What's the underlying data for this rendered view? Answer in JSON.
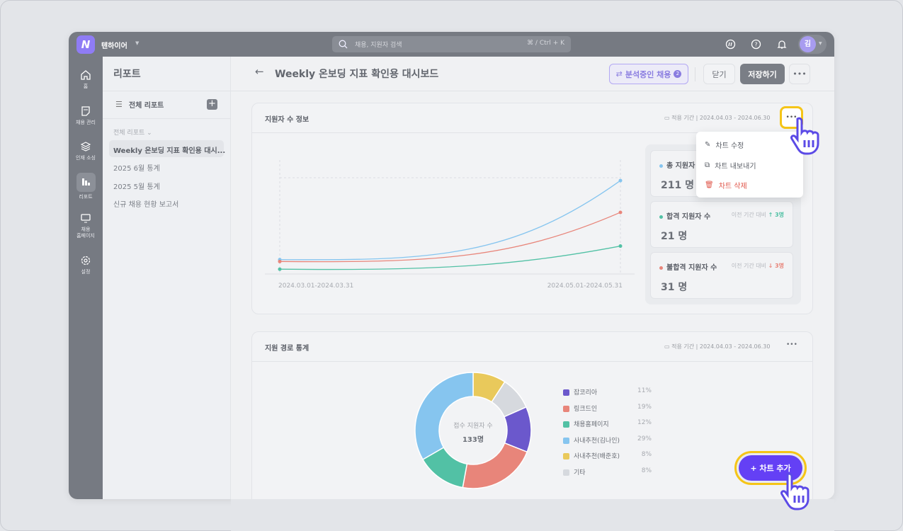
{
  "topbar": {
    "workspace": "텐하이어",
    "search_placeholder": "채용, 지원자 검색",
    "search_shortcut": "⌘ / Ctrl + K",
    "avatar": "김",
    "icons": [
      "chat-icon",
      "help-icon",
      "bell-icon"
    ]
  },
  "rail": [
    {
      "label": "홈",
      "icon": "home-icon"
    },
    {
      "label": "채용 관리",
      "icon": "note-icon"
    },
    {
      "label": "인재 소싱",
      "icon": "layers-icon"
    },
    {
      "label": "리포트",
      "icon": "bar-chart-icon",
      "active": true
    },
    {
      "label": "채용\n홈페이지",
      "icon": "monitor-icon"
    },
    {
      "label": "설정",
      "icon": "gear-icon"
    }
  ],
  "sidebar": {
    "title": "리포트",
    "all_reports": "전체 리포트",
    "section": "전체 리포트",
    "items": [
      "Weekly 온보딩 지표 확인용 대시...",
      "2025 6월 통계",
      "2025 5월 통계",
      "신규 채용 현황 보고서"
    ]
  },
  "header": {
    "title": "Weekly 온보딩 지표 확인용 대시보드",
    "analyzing": "분석중인 채용",
    "analyzing_count": "2",
    "close": "닫기",
    "save": "저장하기"
  },
  "card1": {
    "title": "지원자 수 정보",
    "period_label": "적용 기간",
    "period": "2024.04.03 - 2024.06.30",
    "stats": [
      {
        "label": "총 지원자 수",
        "value": "211 명",
        "color": "#86c5ef"
      },
      {
        "label": "합격 지원자 수",
        "value": "21 명",
        "compare": "이전 기간 대비",
        "delta": "↑ 3명",
        "color": "#52c1a5"
      },
      {
        "label": "불합격 지원자 수",
        "value": "31 명",
        "compare": "이전 기간 대비",
        "delta": "↓ 3명",
        "color": "#e8857a"
      }
    ]
  },
  "menu": {
    "items": [
      {
        "label": "차트 수정",
        "icon": "pencil-icon"
      },
      {
        "label": "차트 내보내기",
        "icon": "copy-icon"
      },
      {
        "label": "차트 삭제",
        "icon": "trash-icon",
        "danger": true
      }
    ]
  },
  "card2": {
    "title": "지원 경로 통계",
    "period_label": "적용 기간",
    "period": "2024.04.03 - 2024.06.30",
    "center_label": "접수 지원자 수",
    "center_value": "133명"
  },
  "add_chart": "+ 차트 추가",
  "chart_data": [
    {
      "type": "line",
      "categories": [
        "2024.03.01-2024.03.31",
        "2024.05.01-2024.05.31"
      ],
      "ylim": [
        0,
        100
      ],
      "grid": false,
      "series": [
        {
          "color": "#86c5ef",
          "values": [
            15,
            97
          ]
        },
        {
          "color": "#e8857a",
          "values": [
            13,
            64
          ]
        },
        {
          "color": "#52c1a5",
          "values": [
            5,
            29
          ]
        }
      ]
    },
    {
      "type": "pie",
      "categories": [
        "잡코리아",
        "링크드인",
        "채용홈페이지",
        "사내추천(김나인)",
        "사내추천(배준호)",
        "기타"
      ],
      "values": [
        11,
        19,
        12,
        29,
        8,
        8
      ],
      "labels": [
        "11%",
        "19%",
        "12%",
        "29%",
        "8%",
        "8%"
      ],
      "colors": [
        "#6b58cc",
        "#e8857a",
        "#52c1a5",
        "#86c5ef",
        "#e9c95b",
        "#d6d9de"
      ]
    }
  ]
}
